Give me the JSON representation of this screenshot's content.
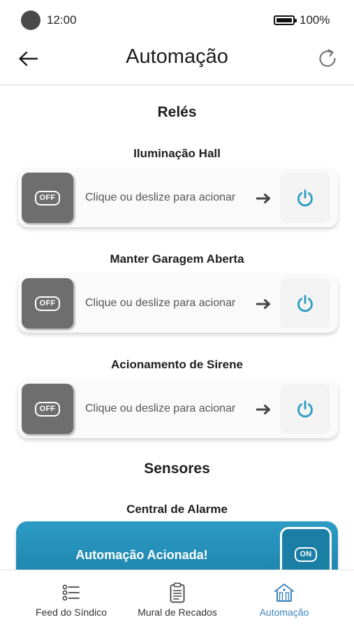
{
  "status_bar": {
    "time": "12:00",
    "battery": "100%"
  },
  "header": {
    "title": "Automação",
    "back_icon": "arrow-left-icon",
    "refresh_icon": "refresh-icon"
  },
  "relays": {
    "section_title": "Relés",
    "hint": "Clique ou deslize para acionar",
    "items": [
      {
        "label": "Iluminação Hall",
        "state": "OFF"
      },
      {
        "label": "Manter Garagem Aberta",
        "state": "OFF"
      },
      {
        "label": "Acionamento de Sirene",
        "state": "OFF"
      }
    ]
  },
  "sensors": {
    "section_title": "Sensores",
    "items": [
      {
        "label": "Central de Alarme",
        "status": "Automação Acionada!",
        "state": "ON"
      }
    ]
  },
  "bottom_nav": {
    "items": [
      {
        "label": "Feed do Síndico",
        "icon": "list-icon",
        "active": false
      },
      {
        "label": "Mural de Recados",
        "icon": "clipboard-icon",
        "active": false
      },
      {
        "label": "Automação",
        "icon": "building-icon",
        "active": true
      }
    ]
  },
  "colors": {
    "accent": "#1f8ab3",
    "power_icon": "#2a9bc3",
    "off_knob": "#6e6e6e",
    "nav_active": "#3e83bc"
  }
}
